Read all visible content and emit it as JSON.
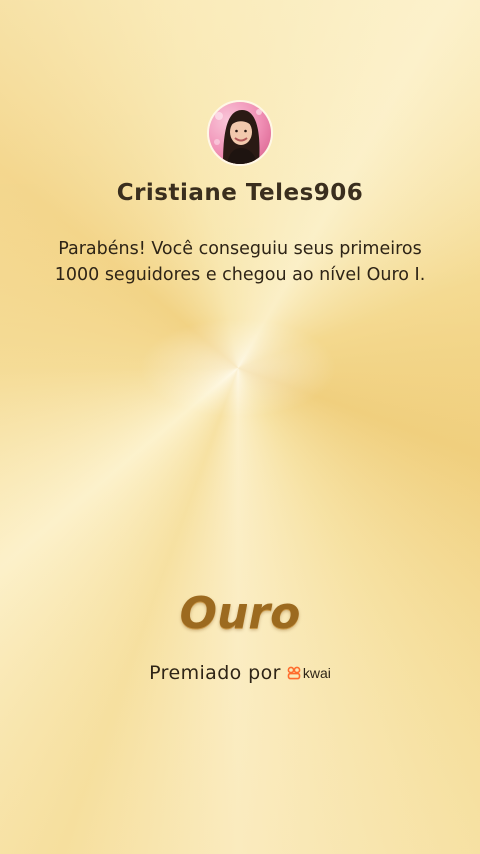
{
  "profile": {
    "username": "Cristiane Teles906",
    "avatar_icon": "user-avatar-photo"
  },
  "achievement": {
    "message": "Parabéns! Você conseguiu seus primeiros 1000 seguidores e chegou ao nível Ouro I.",
    "level": "Ouro"
  },
  "sponsor": {
    "awarded_by": "Premiado por",
    "brand": "kwai",
    "brand_icon": "kwai-logo-icon",
    "brand_color": "#ff6b2c"
  },
  "colors": {
    "background": "#f7e2a4",
    "level_text": "#9c6a1f",
    "text": "#2e2416"
  }
}
